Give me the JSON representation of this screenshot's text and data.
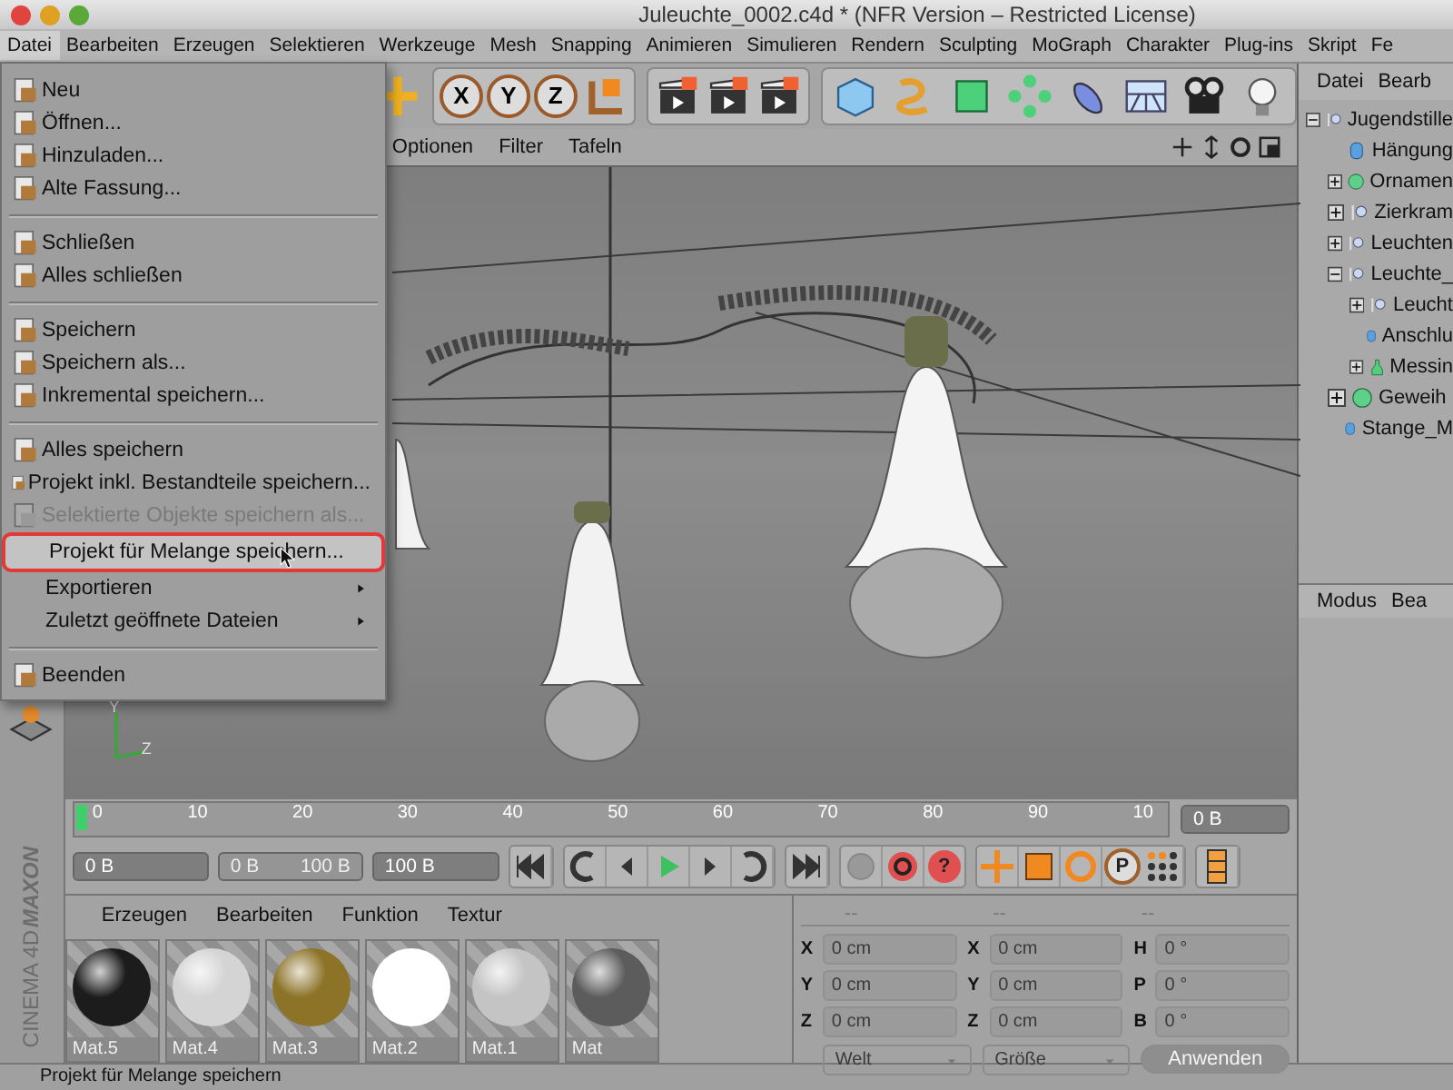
{
  "window": {
    "title": "Juleuchte_0002.c4d * (NFR Version – Restricted License)"
  },
  "menu_bar": [
    {
      "label": "Datei",
      "selected": true
    },
    {
      "label": "Bearbeiten",
      "selected": false
    },
    {
      "label": "Erzeugen",
      "selected": false
    },
    {
      "label": "Selektieren",
      "selected": false
    },
    {
      "label": "Werkzeuge",
      "selected": false
    },
    {
      "label": "Mesh",
      "selected": false
    },
    {
      "label": "Snapping",
      "selected": false
    },
    {
      "label": "Animieren",
      "selected": false
    },
    {
      "label": "Simulieren",
      "selected": false
    },
    {
      "label": "Rendern",
      "selected": false
    },
    {
      "label": "Sculpting",
      "selected": false
    },
    {
      "label": "MoGraph",
      "selected": false
    },
    {
      "label": "Charakter",
      "selected": false
    },
    {
      "label": "Plug-ins",
      "selected": false
    },
    {
      "label": "Skript",
      "selected": false
    },
    {
      "label": "Fe",
      "selected": false
    }
  ],
  "file_menu": [
    {
      "kind": "icon_item",
      "label": "Neu",
      "selected": false,
      "disabled": false,
      "submenu": false
    },
    {
      "kind": "icon_item",
      "label": "Öffnen...",
      "selected": false,
      "disabled": false,
      "submenu": false
    },
    {
      "kind": "icon_item",
      "label": "Hinzuladen...",
      "selected": false,
      "disabled": false,
      "submenu": false
    },
    {
      "kind": "icon_item",
      "label": "Alte Fassung...",
      "selected": false,
      "disabled": false,
      "submenu": false
    },
    {
      "kind": "separator"
    },
    {
      "kind": "icon_item",
      "label": "Schließen",
      "selected": false,
      "disabled": false,
      "submenu": false
    },
    {
      "kind": "icon_item",
      "label": "Alles schließen",
      "selected": false,
      "disabled": false,
      "submenu": false
    },
    {
      "kind": "separator"
    },
    {
      "kind": "icon_item",
      "label": "Speichern",
      "selected": false,
      "disabled": false,
      "submenu": false
    },
    {
      "kind": "icon_item",
      "label": "Speichern als...",
      "selected": false,
      "disabled": false,
      "submenu": false
    },
    {
      "kind": "icon_item",
      "label": "Inkremental speichern...",
      "selected": false,
      "disabled": false,
      "submenu": false
    },
    {
      "kind": "separator"
    },
    {
      "kind": "icon_item",
      "label": "Alles speichern",
      "selected": false,
      "disabled": false,
      "submenu": false
    },
    {
      "kind": "icon_item",
      "label": "Projekt inkl. Bestandteile speichern...",
      "selected": false,
      "disabled": false,
      "submenu": false
    },
    {
      "kind": "icon_item",
      "label": "Selektierte Objekte speichern als...",
      "selected": false,
      "disabled": true,
      "submenu": false
    },
    {
      "kind": "plain_item",
      "label": "Projekt für Melange speichern...",
      "selected": true,
      "disabled": false,
      "submenu": false
    },
    {
      "kind": "plain_item",
      "label": "Exportieren",
      "selected": false,
      "disabled": false,
      "submenu": true
    },
    {
      "kind": "plain_item",
      "label": "Zuletzt geöffnete Dateien",
      "selected": false,
      "disabled": false,
      "submenu": true
    },
    {
      "kind": "separator"
    },
    {
      "kind": "icon_item",
      "label": "Beenden",
      "selected": false,
      "disabled": false,
      "submenu": false
    }
  ],
  "axis_buttons": [
    "X",
    "Y",
    "Z"
  ],
  "viewport_menu": [
    "Optionen",
    "Filter",
    "Tafeln"
  ],
  "viewport_axes": [
    "Y",
    "Z"
  ],
  "object_manager": {
    "menu": [
      "Datei",
      "Bearb"
    ],
    "tree": [
      {
        "kind": "null",
        "label": "Jugendstille",
        "expanded": true,
        "children": [
          {
            "kind": "cylinder",
            "label": "Hängung"
          },
          {
            "kind": "sphere",
            "label": "Ornamen",
            "expanded": false
          },
          {
            "kind": "null",
            "label": "Zierkram",
            "expanded": false
          },
          {
            "kind": "null",
            "label": "Leuchten",
            "expanded": false
          },
          {
            "kind": "null",
            "label": "Leuchte_",
            "expanded": true,
            "children": [
              {
                "kind": "null",
                "label": "Leucht",
                "expanded": false
              },
              {
                "kind": "cylinder",
                "label": "Anschlu"
              },
              {
                "kind": "lathe",
                "label": "Messin",
                "expanded": false
              }
            ]
          },
          {
            "kind": "sphere",
            "label": "Geweih",
            "expanded": false
          },
          {
            "kind": "cylinder",
            "label": "Stange_M"
          }
        ]
      }
    ]
  },
  "attribute_manager": {
    "menu": [
      "Modus",
      "Bea"
    ]
  },
  "timeline": {
    "ticks": [
      "0",
      "10",
      "20",
      "30",
      "40",
      "50",
      "60",
      "70",
      "80",
      "90",
      "10"
    ],
    "level": 0,
    "current_frame": "0 B"
  },
  "frame_range": {
    "start": "0 B",
    "range_min": "0 B",
    "range_max": "100 B",
    "end": "100 B"
  },
  "coord_buttons": {
    "help": "?",
    "param": "P"
  },
  "material_manager": {
    "menu": [
      "Erzeugen",
      "Bearbeiten",
      "Funktion",
      "Textur"
    ],
    "materials": [
      {
        "name": "Mat.5",
        "color": "#1c1c1c"
      },
      {
        "name": "Mat.4",
        "color": "#d4d4d4"
      },
      {
        "name": "Mat.3",
        "color": "#8c7328"
      },
      {
        "name": "Mat.2",
        "color": "#ffffff"
      },
      {
        "name": "Mat.1",
        "color": "#c4c4c4"
      },
      {
        "name": "Mat",
        "color": "#5c5c5c"
      }
    ]
  },
  "brand": {
    "company": "MAXON",
    "product": "CINEMA 4D"
  },
  "coordinates": {
    "columns": [
      {
        "header": "--",
        "rows": [
          {
            "axis": "X",
            "value": "0 cm"
          },
          {
            "axis": "Y",
            "value": "0 cm"
          },
          {
            "axis": "Z",
            "value": "0 cm"
          }
        ]
      },
      {
        "header": "--",
        "rows": [
          {
            "axis": "X",
            "value": "0 cm"
          },
          {
            "axis": "Y",
            "value": "0 cm"
          },
          {
            "axis": "Z",
            "value": "0 cm"
          }
        ]
      },
      {
        "header": "--",
        "rows": [
          {
            "axis": "H",
            "value": "0 °"
          },
          {
            "axis": "P",
            "value": "0 °"
          },
          {
            "axis": "B",
            "value": "0 °"
          }
        ]
      }
    ],
    "space": "Welt",
    "mode": "Größe",
    "apply": "Anwenden"
  },
  "status_bar": "Projekt für Melange speichern"
}
